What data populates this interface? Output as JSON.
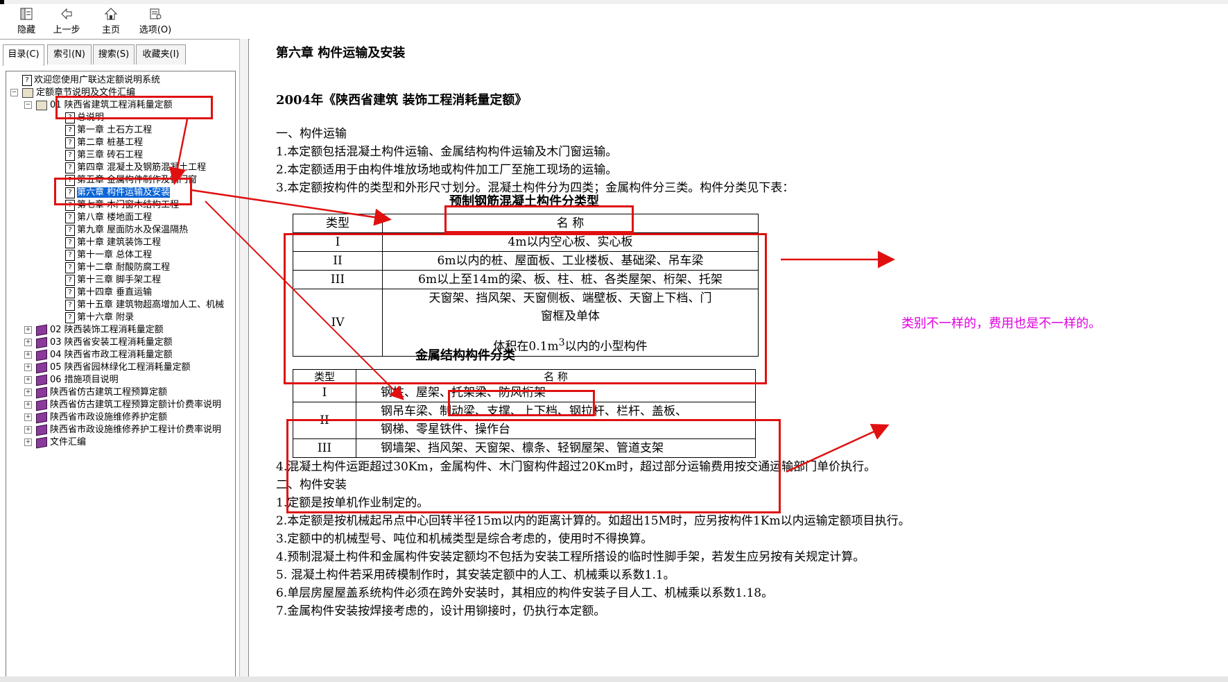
{
  "toolbar": {
    "hide": "隐藏",
    "back": "上一步",
    "home": "主页",
    "options": "选项(O)"
  },
  "tabs": [
    "目录(C)",
    "索引(N)",
    "搜索(S)",
    "收藏夹(I)"
  ],
  "tree": [
    {
      "text": "欢迎您使用广联达定额说明系统",
      "indent": 0,
      "icon": "q",
      "exp": ""
    },
    {
      "text": "定额章节说明及文件汇编",
      "indent": 0,
      "icon": "book-open",
      "exp": "-"
    },
    {
      "text": "01 陕西省建筑工程消耗量定额",
      "indent": 1,
      "icon": "book-open",
      "exp": "-"
    },
    {
      "text": "总说明",
      "indent": 2,
      "icon": "q",
      "exp": ""
    },
    {
      "text": "第一章  土石方工程",
      "indent": 2,
      "icon": "q",
      "exp": ""
    },
    {
      "text": "第二章  桩基工程",
      "indent": 2,
      "icon": "q",
      "exp": ""
    },
    {
      "text": "第三章  砖石工程",
      "indent": 2,
      "icon": "q",
      "exp": ""
    },
    {
      "text": "第四章  混凝土及钢筋混凝土工程",
      "indent": 2,
      "icon": "q",
      "exp": ""
    },
    {
      "text": "第五章  金属构件制作及钢门窗",
      "indent": 2,
      "icon": "q",
      "exp": ""
    },
    {
      "text": "第六章  构件运输及安装",
      "indent": 2,
      "icon": "q",
      "exp": "",
      "selected": true
    },
    {
      "text": "第七章  木门窗木结构工程",
      "indent": 2,
      "icon": "q",
      "exp": ""
    },
    {
      "text": "第八章  楼地面工程",
      "indent": 2,
      "icon": "q",
      "exp": ""
    },
    {
      "text": "第九章  屋面防水及保温隔热",
      "indent": 2,
      "icon": "q",
      "exp": ""
    },
    {
      "text": "第十章  建筑装饰工程",
      "indent": 2,
      "icon": "q",
      "exp": ""
    },
    {
      "text": "第十一章  总体工程",
      "indent": 2,
      "icon": "q",
      "exp": ""
    },
    {
      "text": "第十二章  耐酸防腐工程",
      "indent": 2,
      "icon": "q",
      "exp": ""
    },
    {
      "text": "第十三章  脚手架工程",
      "indent": 2,
      "icon": "q",
      "exp": ""
    },
    {
      "text": "第十四章  垂直运输",
      "indent": 2,
      "icon": "q",
      "exp": ""
    },
    {
      "text": "第十五章  建筑物超高增加人工、机械",
      "indent": 2,
      "icon": "q",
      "exp": ""
    },
    {
      "text": "第十六章  附录",
      "indent": 2,
      "icon": "q",
      "exp": ""
    },
    {
      "text": "02  陕西装饰工程消耗量定额",
      "indent": 1,
      "icon": "book",
      "exp": "+"
    },
    {
      "text": "03  陕西省安装工程消耗量定额",
      "indent": 1,
      "icon": "book",
      "exp": "+"
    },
    {
      "text": "04  陕西省市政工程消耗量定额",
      "indent": 1,
      "icon": "book",
      "exp": "+"
    },
    {
      "text": "05  陕西省园林绿化工程消耗量定额",
      "indent": 1,
      "icon": "book",
      "exp": "+"
    },
    {
      "text": "06  措施项目说明",
      "indent": 1,
      "icon": "book",
      "exp": "+"
    },
    {
      "text": "陕西省仿古建筑工程预算定额",
      "indent": 1,
      "icon": "book",
      "exp": "+"
    },
    {
      "text": "陕西省仿古建筑工程预算定额计价费率说明",
      "indent": 1,
      "icon": "book",
      "exp": "+"
    },
    {
      "text": "陕西省市政设施维修养护定额",
      "indent": 1,
      "icon": "book",
      "exp": "+"
    },
    {
      "text": "陕西省市政设施维修养护工程计价费率说明",
      "indent": 1,
      "icon": "book",
      "exp": "+"
    },
    {
      "text": "文件汇编",
      "indent": 1,
      "icon": "book",
      "exp": "+"
    }
  ],
  "content": {
    "chapter_title": "第六章    构件运输及安装",
    "doc_title": "2004年《陕西省建筑 装饰工程消耗量定额》",
    "s1_heading": "一、构件运输",
    "s1_lines": [
      "1.本定额包括混凝土构件运输、金属结构构件运输及木门窗运输。",
      "2.本定额适用于由构件堆放场地或构件加工厂至施工现场的运输。",
      "3.本定额按构件的类型和外形尺寸划分。混凝土构件分为四类；金属构件分三类。构件分类见下表："
    ],
    "table1": {
      "caption": "预制钢筋混凝土构件分类型",
      "header": [
        "类型",
        "名          称"
      ],
      "rows": [
        {
          "type": "I",
          "name": "4m以内空心板、实心板"
        },
        {
          "type": "II",
          "name": "6m以内的桩、屋面板、工业楼板、基础梁、吊车梁"
        },
        {
          "type": "III",
          "name": "6m以上至14m的梁、板、柱、桩、各类屋架、桁架、托架"
        },
        {
          "type": "IV",
          "name": "天窗架、挡风架、天窗侧板、端壁板、天窗上下档、门窗框及单体",
          "name_line1": "天窗架、挡风架、天窗侧板、端壁板、天窗上下档、门",
          "name_line2": "窗框及单体",
          "name_line3_a": "体积在0.1m",
          "name_line3_sup": "3",
          "name_line3_b": "以内的小型构件"
        }
      ]
    },
    "table2": {
      "caption": "金属结构构件分类",
      "header": [
        "类型",
        "名                    称"
      ],
      "rows": [
        {
          "type": "I",
          "name": "钢柱、屋架、托架梁、防风桁架"
        },
        {
          "type": "II",
          "name_line1": "钢吊车梁、制动梁、支撑、上下档、钢拉杆、栏杆、盖板、",
          "name_line2": "钢梯、零星铁件、操作台"
        },
        {
          "type": "III",
          "name": "钢墙架、挡风架、天窗架、檩条、轻钢屋架、管道支架"
        }
      ]
    },
    "after_lines": [
      "4.混凝土构件运距超过30Km，金属构件、木门窗构件超过20Km时，超过部分运输费用按交通运输部门单价执行。",
      "二、构件安装",
      "1.定额是按单机作业制定的。",
      "2.本定额是按机械起吊点中心回转半径15m以内的距离计算的。如超出15M时，应另按构件1Km以内运输定额项目执行。",
      "3.定额中的机械型号、吨位和机械类型是综合考虑的，使用时不得换算。",
      "4.预制混凝土构件和金属构件安装定额均不包括为安装工程所搭设的临时性脚手架，若发生应另按有关规定计算。",
      "5.  混凝土构件若采用砖模制作时，其安装定额中的人工、机械乘以系数1.1。",
      "6.单层房屋屋盖系统构件必须在跨外安装时，其相应的构件安装子目人工、机械乘以系数1.18。",
      "7.金属构件安装按焊接考虑的，设计用铆接时，仍执行本定额。"
    ],
    "annotation": "类别不一样的，费用也是不一样的。"
  },
  "colors": {
    "annotation_red": "#e01010",
    "annotation_pink": "#e000e0",
    "selection_blue": "#0a64d4"
  }
}
